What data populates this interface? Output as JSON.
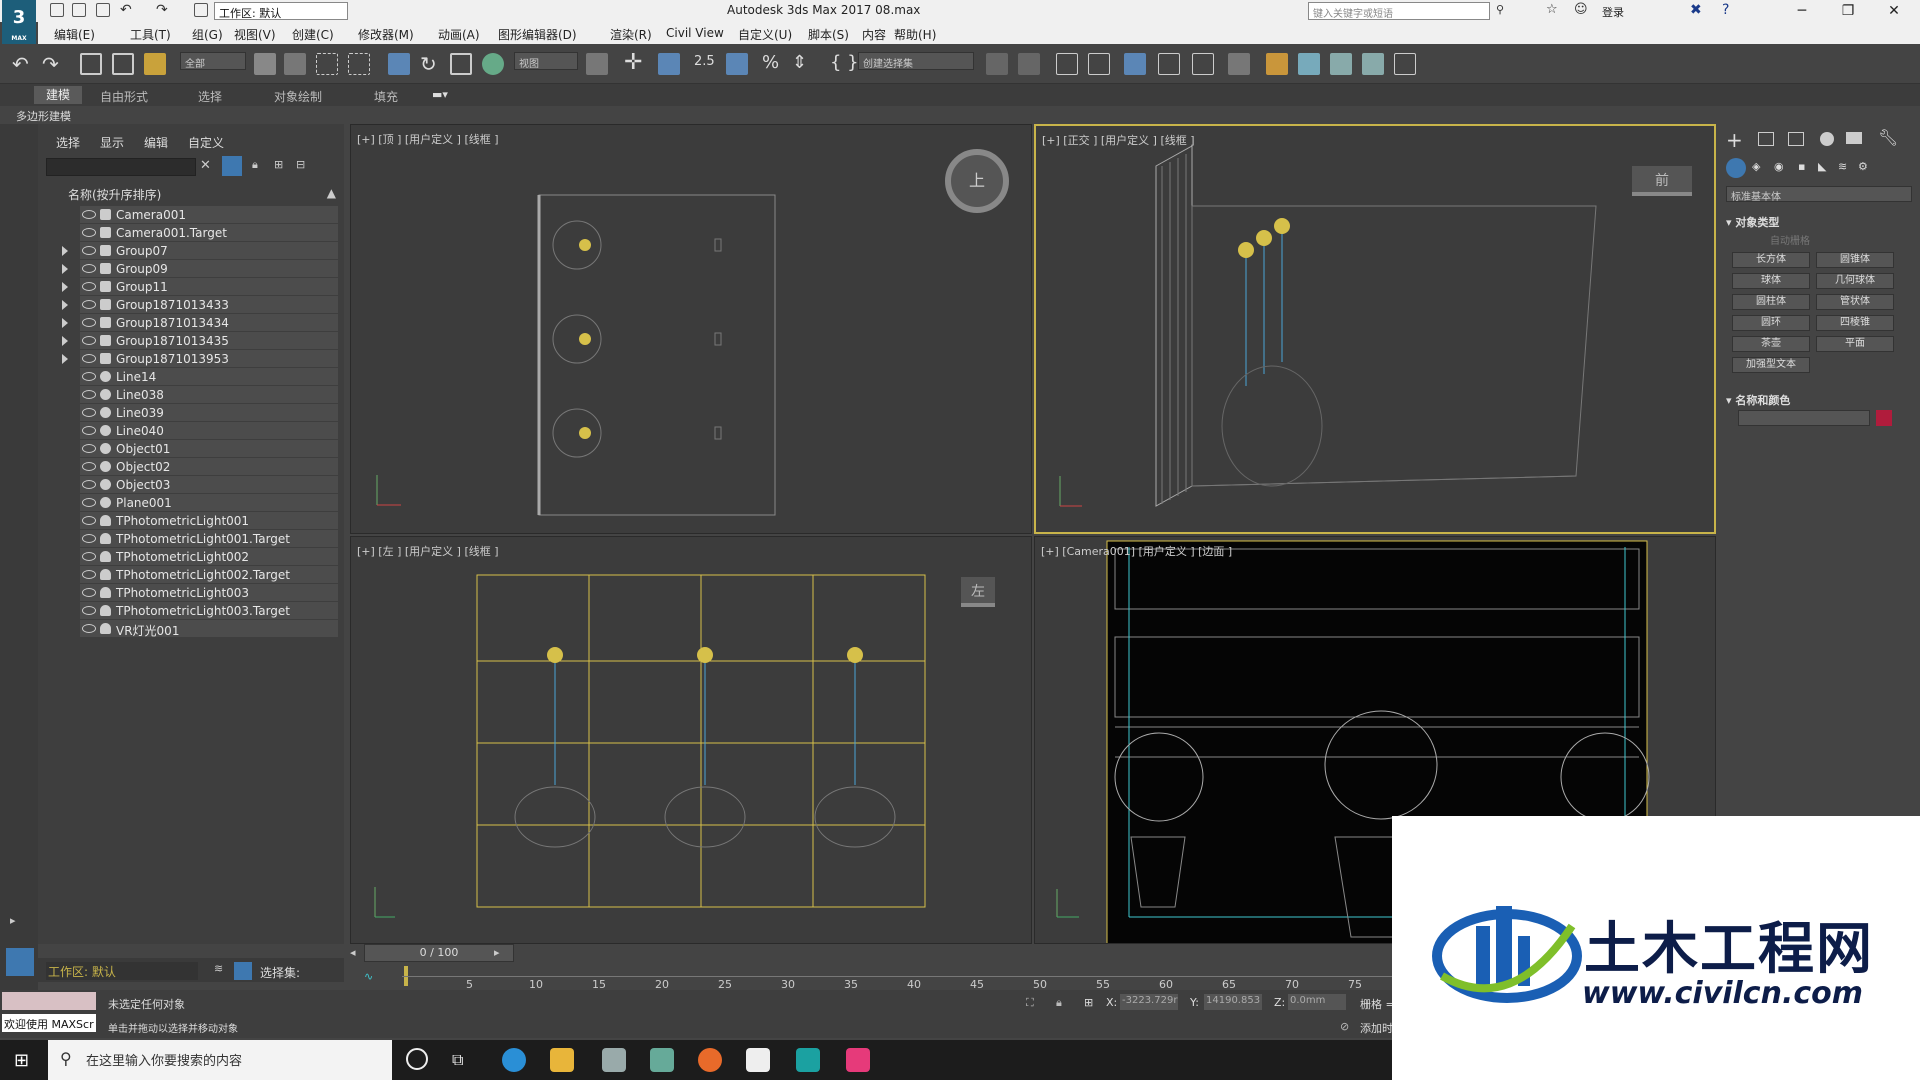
{
  "window": {
    "title": "Autodesk 3ds Max 2017      08.max",
    "workspace_combo": "工作区: 默认",
    "search_placeholder": "键入关键字或短语",
    "login": "登录",
    "min": "─",
    "max": "❐",
    "close": "✕",
    "logo": "3",
    "logo_sub": "MAX"
  },
  "menus": [
    "编辑(E)",
    "工具(T)",
    "组(G)",
    "视图(V)",
    "创建(C)",
    "修改器(M)",
    "动画(A)",
    "图形编辑器(D)",
    "渲染(R)",
    "Civil View",
    "自定义(U)",
    "脚本(S)",
    "内容",
    "帮助(H)"
  ],
  "toolbar": {
    "filter_combo": "全部",
    "refcoord_combo": "视图",
    "selection_set_combo": "创建选择集",
    "snap_label": "2.5"
  },
  "ribbon": {
    "tabs": [
      "建模",
      "自由形式",
      "选择",
      "对象绘制",
      "填充"
    ],
    "active_tab": "建模",
    "sub": "多边形建模"
  },
  "explorer": {
    "tabs": [
      "选择",
      "显示",
      "编辑",
      "自定义"
    ],
    "column_header": "名称(按升序排序)",
    "rows": [
      {
        "name": "Camera001",
        "type": "camera",
        "group": false
      },
      {
        "name": "Camera001.Target",
        "type": "camera",
        "group": false
      },
      {
        "name": "Group07",
        "type": "group",
        "group": true
      },
      {
        "name": "Group09",
        "type": "group",
        "group": true
      },
      {
        "name": "Group11",
        "type": "group",
        "group": true
      },
      {
        "name": "Group1871013433",
        "type": "group",
        "group": true
      },
      {
        "name": "Group1871013434",
        "type": "group",
        "group": true
      },
      {
        "name": "Group1871013435",
        "type": "group",
        "group": true
      },
      {
        "name": "Group1871013953",
        "type": "group",
        "group": true
      },
      {
        "name": "Line14",
        "type": "geometry",
        "group": false
      },
      {
        "name": "Line038",
        "type": "geometry",
        "group": false
      },
      {
        "name": "Line039",
        "type": "geometry",
        "group": false
      },
      {
        "name": "Line040",
        "type": "geometry",
        "group": false
      },
      {
        "name": "Object01",
        "type": "geometry",
        "group": false
      },
      {
        "name": "Object02",
        "type": "geometry",
        "group": false
      },
      {
        "name": "Object03",
        "type": "geometry",
        "group": false
      },
      {
        "name": "Plane001",
        "type": "geometry",
        "group": false
      },
      {
        "name": "TPhotometricLight001",
        "type": "light",
        "group": false
      },
      {
        "name": "TPhotometricLight001.Target",
        "type": "light",
        "group": false
      },
      {
        "name": "TPhotometricLight002",
        "type": "light",
        "group": false
      },
      {
        "name": "TPhotometricLight002.Target",
        "type": "light",
        "group": false
      },
      {
        "name": "TPhotometricLight003",
        "type": "light",
        "group": false
      },
      {
        "name": "TPhotometricLight003.Target",
        "type": "light",
        "group": false
      },
      {
        "name": "VR灯光001",
        "type": "light",
        "group": false
      }
    ],
    "workspace": "工作区: 默认",
    "selection_set": "选择集:"
  },
  "viewports": [
    {
      "label": "[+] [顶 ] [用户定义 ] [线框 ]",
      "gizmo": "上"
    },
    {
      "label": "[+] [正交 ] [用户定义 ] [线框 ]",
      "gizmo": "前"
    },
    {
      "label": "[+] [左 ] [用户定义 ] [线框 ]",
      "gizmo": "左"
    },
    {
      "label": "[+] [Camera001] [用户定义 ] [边面 ]",
      "gizmo": ""
    }
  ],
  "command_panel": {
    "category_combo": "标准基本体",
    "rollout_object_type": "对象类型",
    "auto_grid": "自动栅格",
    "buttons": [
      "长方体",
      "圆锥体",
      "球体",
      "几何球体",
      "圆柱体",
      "管状体",
      "圆环",
      "四棱锥",
      "茶壶",
      "平面",
      "加强型文本"
    ],
    "rollout_name_color": "名称和颜色",
    "color": "#b01c3c"
  },
  "timeline": {
    "slider": "0 / 100",
    "ticks": [
      "5",
      "10",
      "15",
      "20",
      "25",
      "30",
      "35",
      "40",
      "45",
      "50",
      "55",
      "60",
      "65",
      "70",
      "75"
    ]
  },
  "status": {
    "line1": "未选定任何对象",
    "line2": "单击并拖动以选择并移动对象",
    "welcome": "欢迎使用 MAXScr",
    "x_label": "X:",
    "x_value": "-3223.729r",
    "y_label": "Y:",
    "y_value": "14190.853",
    "z_label": "Z:",
    "z_value": "0.0mm",
    "grid": "栅格 =",
    "addtime": "添加时"
  },
  "taskbar": {
    "search": "在这里输入你要搜索的内容"
  },
  "watermark": {
    "cn": "土木工程网",
    "url": "www.civilcn.com"
  }
}
